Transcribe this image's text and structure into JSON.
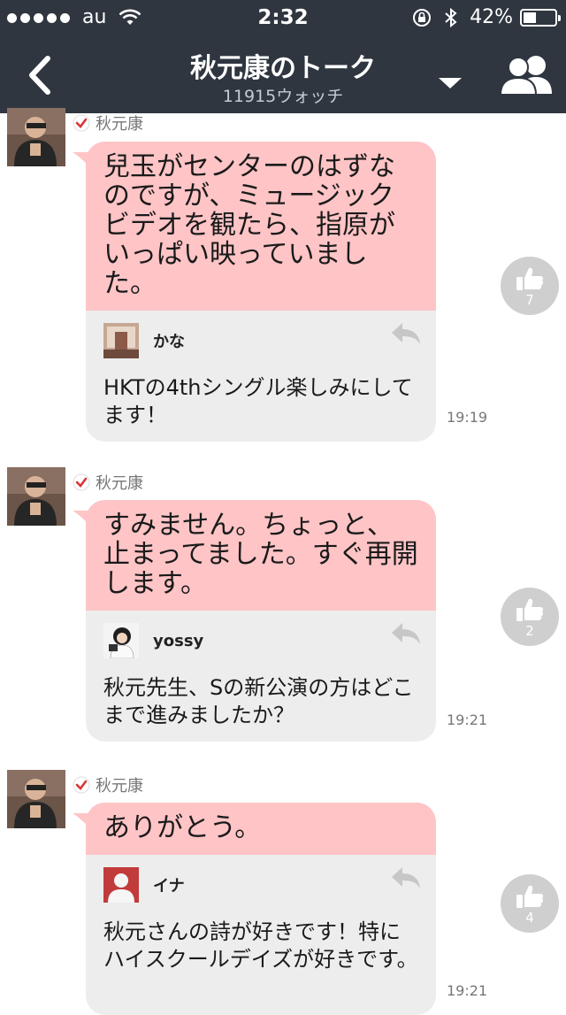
{
  "status_bar": {
    "carrier": "au",
    "time": "2:32",
    "battery_text": "42%",
    "battery_level": 0.42
  },
  "nav": {
    "back_icon": "chevron-left-icon",
    "title": "秋元康のトーク",
    "subtitle": "11915ウォッチ",
    "dropdown_icon": "caret-down-icon",
    "members_icon": "people-icon"
  },
  "colors": {
    "header_bg": "#2f3640",
    "bubble_pink": "#ffc4c6",
    "bubble_gray": "#ededed",
    "like_gray": "#cfcfcf",
    "check_red": "#d9353a"
  },
  "messages": [
    {
      "sender": "秋元康",
      "text": "兒玉がセンターのはずなのですが、ミュージックビデオを観たら、指原がいっぱい映っていました。",
      "quote": {
        "name": "かな",
        "text": "HKTの4thシングル楽しみにしてます！"
      },
      "time": "19:19",
      "likes": "7"
    },
    {
      "sender": "秋元康",
      "text": "すみません。ちょっと、止まってました。すぐ再開します。",
      "quote": {
        "name": "yossy",
        "text": "秋元先生、Sの新公演の方はどこまで進みましたか？"
      },
      "time": "19:21",
      "likes": "2"
    },
    {
      "sender": "秋元康",
      "text": "ありがとう。",
      "quote": {
        "name": "イナ",
        "text": "秋元さんの詩が好きです！特にハイスクールデイズが好きです。"
      },
      "time": "19:21",
      "likes": "4"
    }
  ]
}
